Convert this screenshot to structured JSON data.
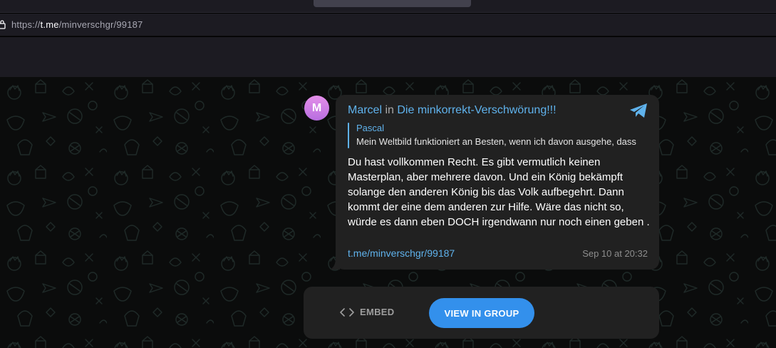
{
  "browser": {
    "url_prefix": "https://",
    "url_domain": "t.me",
    "url_path": "/minverschgr/99187"
  },
  "post": {
    "avatar_letter": "M",
    "author_name": "Marcel",
    "author_sep": "in",
    "group_name": "Die minkorrekt-Verschwörung!!!",
    "reply": {
      "author": "Pascal",
      "text": "Mein Weltbild funktioniert an Besten, wenn ich davon ausgehe, dass"
    },
    "message": "Du hast vollkommen Recht. Es gibt vermutlich keinen Masterplan, aber mehrere davon. Und ein König bekämpft solange den anderen König bis das Volk aufbegehrt. Dann kommt der eine dem anderen zur Hilfe. Wäre das nicht so, würde es dann eben DOCH irgendwann nur noch einen geben .",
    "link": "t.me/minverschgr/99187",
    "timestamp": "Sep 10 at 20:32"
  },
  "actions": {
    "embed_label": "EMBED",
    "view_label": "VIEW IN GROUP"
  },
  "colors": {
    "accent": "#5fb2ec",
    "button": "#3390ec",
    "bubble": "#212121",
    "background": "#0b0c0c"
  }
}
